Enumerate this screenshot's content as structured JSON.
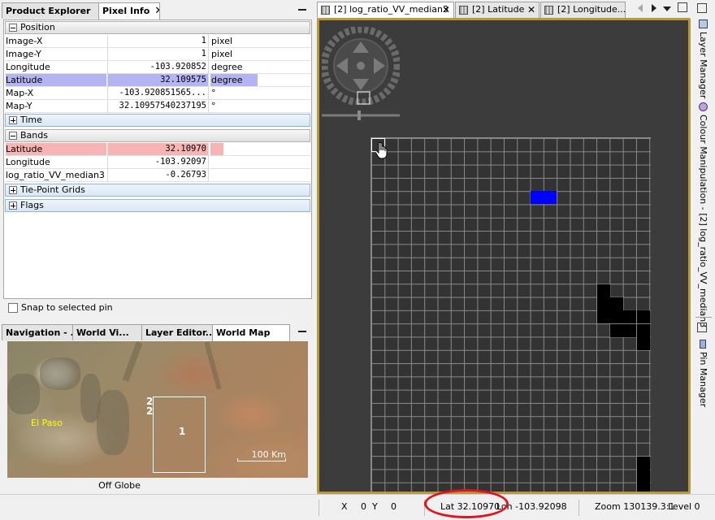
{
  "left_tabs": [
    {
      "label": "Product Explorer",
      "active": false
    },
    {
      "label": "Pixel Info",
      "active": true
    }
  ],
  "pixel_info": {
    "sections": {
      "position": "Position",
      "time": "Time",
      "bands": "Bands",
      "tie_point_grids": "Tie-Point Grids",
      "flags": "Flags"
    },
    "position_rows": [
      {
        "name": "Image-X",
        "value": "1",
        "unit": "pixel"
      },
      {
        "name": "Image-Y",
        "value": "1",
        "unit": "pixel"
      },
      {
        "name": "Longitude",
        "value": "-103.920852",
        "unit": "degree"
      },
      {
        "name": "Latitude",
        "value": "32.109575",
        "unit": "degree"
      },
      {
        "name": "Map-X",
        "value": "-103.920851565...",
        "unit": "°"
      },
      {
        "name": "Map-Y",
        "value": "32.10957540237195",
        "unit": "°"
      }
    ],
    "band_rows": [
      {
        "name": "Latitude",
        "value": "32.10970",
        "unit": ""
      },
      {
        "name": "Longitude",
        "value": "-103.92097",
        "unit": ""
      },
      {
        "name": "log_ratio_VV_median3",
        "value": "-0.26793",
        "unit": ""
      }
    ],
    "snap_label": "Snap to selected pin"
  },
  "nav_tabs": [
    {
      "label": "Navigation - ..."
    },
    {
      "label": "World Vi..."
    },
    {
      "label": "Layer Editor..."
    },
    {
      "label": "World Map"
    }
  ],
  "world_map": {
    "city": "El Paso",
    "label_a": "2",
    "label_b": "2",
    "label_c": "1",
    "scale": "100 Km",
    "footer": "Off Globe"
  },
  "doc_tabs": [
    {
      "label": "[2] log_ratio_VV_median3",
      "active": true
    },
    {
      "label": "[2] Latitude",
      "active": false
    },
    {
      "label": "[2] Longitude...",
      "active": false
    }
  ],
  "right_tabs": {
    "layer_manager": "Layer Manager",
    "colour_manipulation": "Colour Manipulation - [2] log_ratio_VV_median3",
    "pin_manager": "Pin Manager"
  },
  "status": {
    "x_label": "X",
    "x_value": "0",
    "y_label": "Y",
    "y_value": "0",
    "lat": "Lat 32.10970",
    "lon": "Lon -103.92098",
    "zoom": "Zoom 130139.3:1",
    "level": "Level 0"
  },
  "colors": {
    "highlight_lat_position": "#b4b4f2",
    "highlight_lat_band": "#f6b4b4",
    "frame": "#b89a3c",
    "annotation": "#e0141e"
  }
}
